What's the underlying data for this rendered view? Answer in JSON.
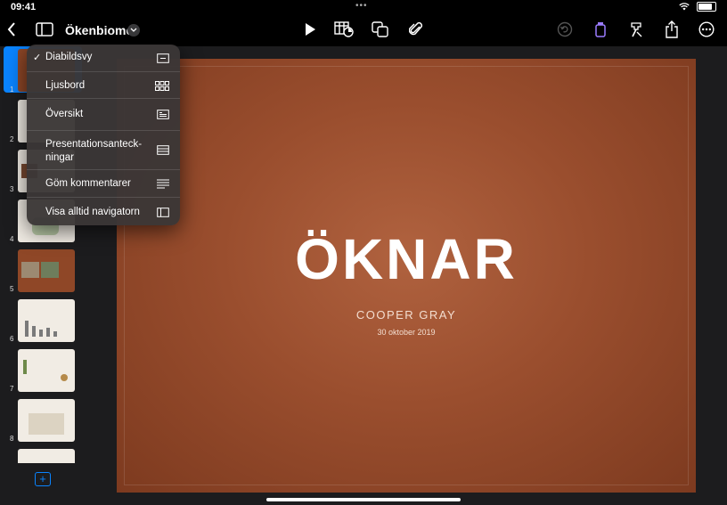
{
  "status_bar": {
    "time": "09:41"
  },
  "toolbar": {
    "document_title": "Ökenbiomet",
    "icons": [
      "back-chevron-icon",
      "sidebar-icon",
      "title-chevron-icon",
      "play-icon",
      "table-chart-icon",
      "shapes-icon",
      "paperclip-icon",
      "undo-icon",
      "format-brush-icon",
      "animation-hammer-icon",
      "share-icon",
      "more-icon"
    ]
  },
  "view_menu": {
    "items": [
      {
        "label": "Diabildsvy",
        "checked": true,
        "icon": "slide-view-icon"
      },
      {
        "label": "Ljusbord",
        "checked": false,
        "icon": "light-table-icon"
      },
      {
        "label": "Översikt",
        "checked": false,
        "icon": "outline-view-icon"
      },
      {
        "label": "Presentationsanteck-\nningar",
        "checked": false,
        "icon": "presenter-notes-icon"
      },
      {
        "label": "Göm kommentarer",
        "checked": false,
        "icon": "comments-icon"
      },
      {
        "label": "Visa alltid navigatorn",
        "checked": false,
        "icon": "navigator-icon"
      }
    ]
  },
  "navigator": {
    "slides": [
      "1",
      "2",
      "3",
      "4",
      "5",
      "6",
      "7",
      "8"
    ]
  },
  "slide": {
    "title": "ÖKNAR",
    "author": "COOPER GRAY",
    "date": "30 oktober 2019"
  },
  "colors": {
    "accent": "#0a84ff",
    "slide_bg": "#9a4e2e",
    "menu_bg": "#3a3636"
  }
}
